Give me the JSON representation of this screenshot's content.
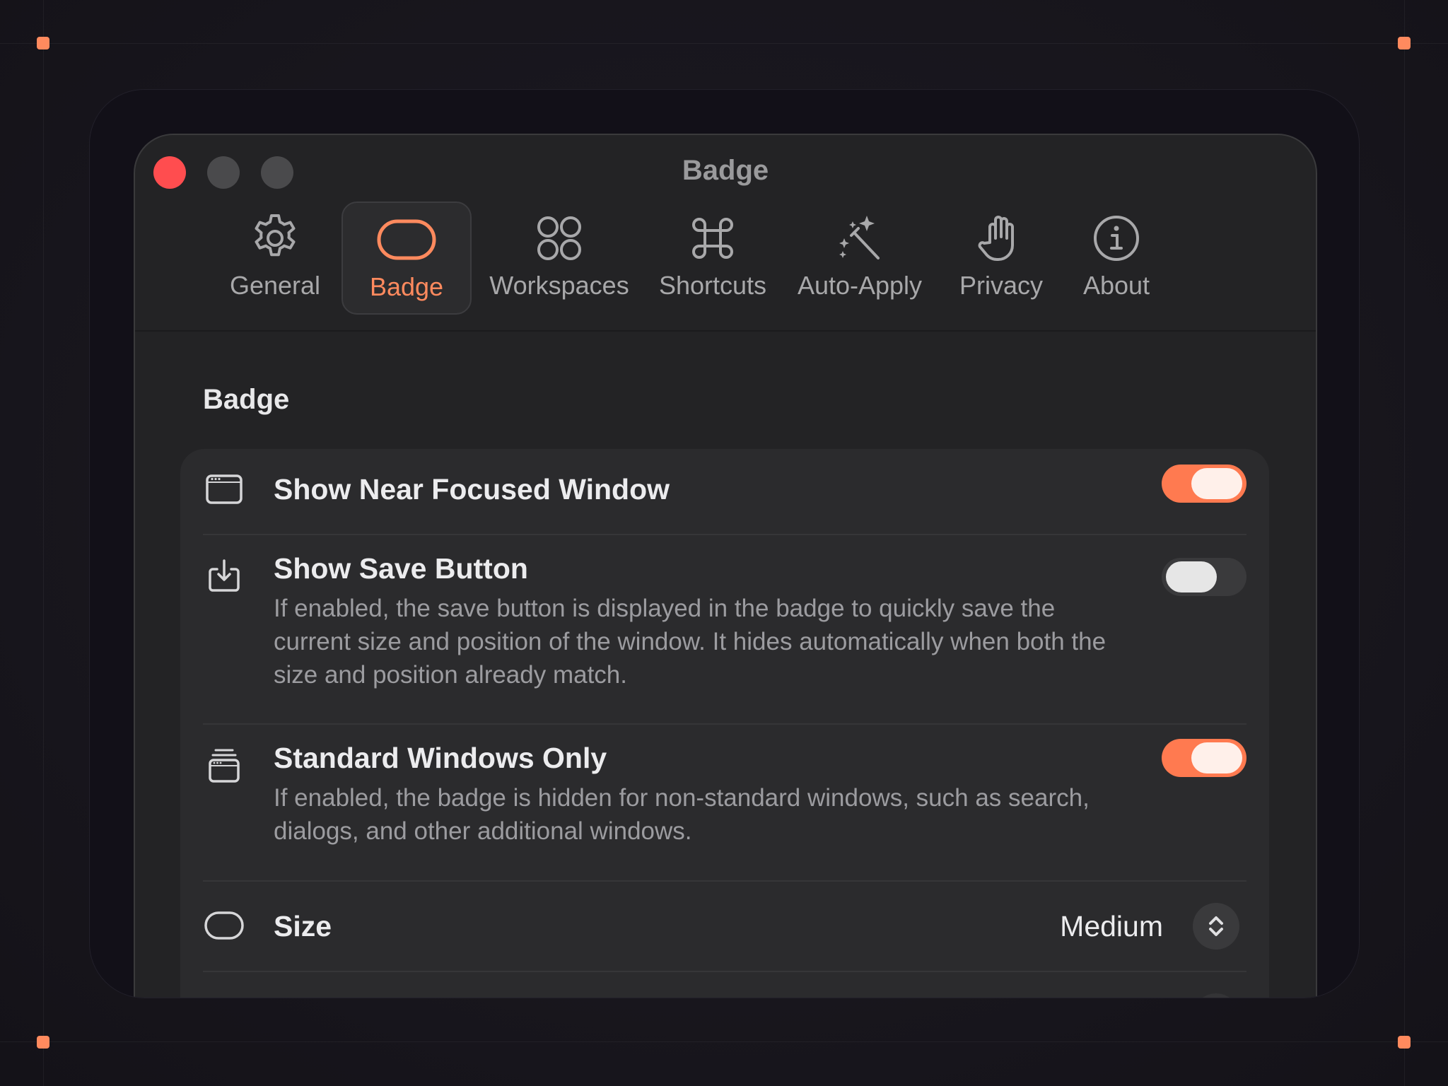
{
  "window": {
    "title": "Badge"
  },
  "toolbar": {
    "tabs": [
      {
        "label": "General",
        "icon": "gear-icon"
      },
      {
        "label": "Badge",
        "icon": "badge-capsule-icon",
        "active": true
      },
      {
        "label": "Workspaces",
        "icon": "four-circles-icon"
      },
      {
        "label": "Shortcuts",
        "icon": "command-key-icon"
      },
      {
        "label": "Auto-Apply",
        "icon": "magic-wand-icon"
      },
      {
        "label": "Privacy",
        "icon": "hand-icon"
      },
      {
        "label": "About",
        "icon": "info-circle-icon"
      }
    ]
  },
  "content": {
    "heading": "Badge",
    "rows": [
      {
        "icon": "window-icon",
        "title": "Show Near Focused Window",
        "toggle": true
      },
      {
        "icon": "save-tray-icon",
        "title": "Show Save Button",
        "description": "If enabled, the save button is displayed in the badge to quickly save the current size and position of the window. It hides automatically when both the size and position already match.",
        "toggle": false
      },
      {
        "icon": "stacked-windows-icon",
        "title": "Standard Windows Only",
        "description": "If enabled, the badge is hidden for non-standard windows, such as search, dialogs, and other additional windows.",
        "toggle": true
      },
      {
        "icon": "capsule-icon",
        "title": "Size",
        "value": "Medium"
      }
    ]
  },
  "colors": {
    "accent": "#ff7a50",
    "close": "#ff4d4f",
    "handle": "#ff8a5e"
  }
}
